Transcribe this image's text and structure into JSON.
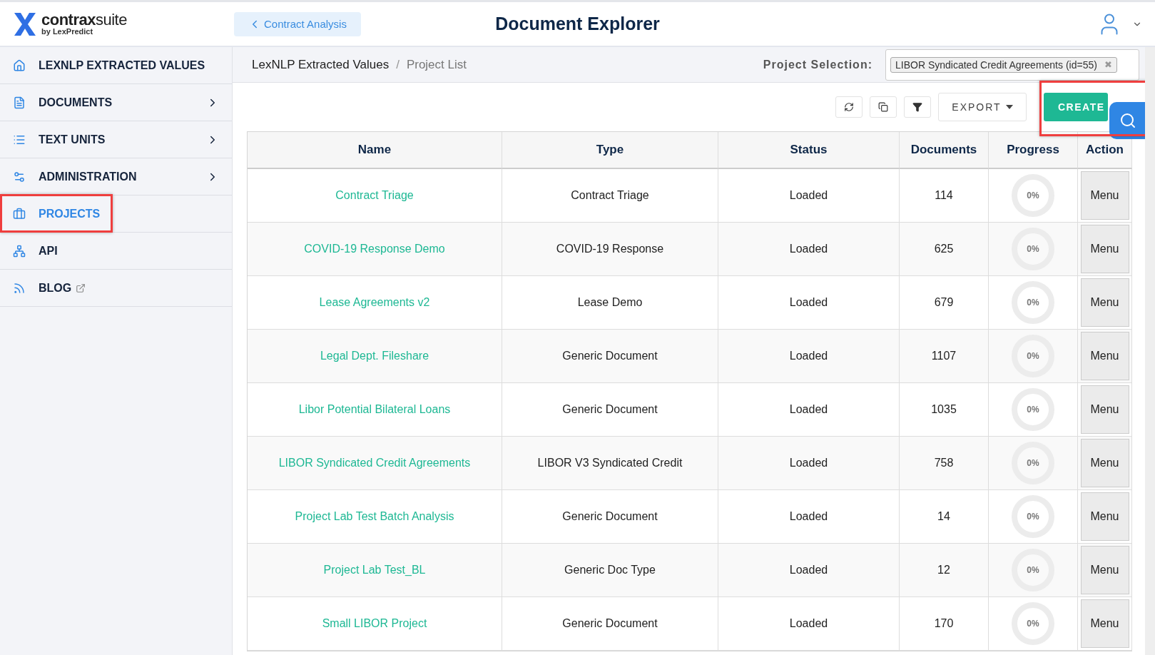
{
  "header": {
    "logo": {
      "name": "contrax",
      "suffix": "suite",
      "byline": "by LexPredict"
    },
    "back_button": "Contract Analysis",
    "title": "Document Explorer"
  },
  "sidebar": {
    "items": [
      {
        "label": "LEXNLP EXTRACTED VALUES",
        "has_children": false,
        "selected": false,
        "highlighted": false
      },
      {
        "label": "DOCUMENTS",
        "has_children": true,
        "selected": false,
        "highlighted": false
      },
      {
        "label": "TEXT UNITS",
        "has_children": true,
        "selected": false,
        "highlighted": false
      },
      {
        "label": "ADMINISTRATION",
        "has_children": true,
        "selected": false,
        "highlighted": false
      },
      {
        "label": "PROJECTS",
        "has_children": false,
        "selected": true,
        "highlighted": true
      },
      {
        "label": "API",
        "has_children": false,
        "selected": false,
        "highlighted": false
      },
      {
        "label": "BLOG",
        "has_children": false,
        "external": true,
        "selected": false,
        "highlighted": false
      }
    ]
  },
  "breadcrumb": {
    "items": [
      "LexNLP Extracted Values",
      "Project List"
    ],
    "separator": "/"
  },
  "project_selection": {
    "label": "Project Selection:",
    "value": "LIBOR Syndicated Credit Agreements (id=55)",
    "remove": "✖"
  },
  "toolbar": {
    "export": "EXPORT",
    "create": "CREATE",
    "create_highlighted": true
  },
  "table": {
    "columns": [
      "Name",
      "Type",
      "Status",
      "Documents",
      "Progress",
      "Action"
    ],
    "rows": [
      {
        "name": "Contract Triage",
        "type": "Contract Triage",
        "status": "Loaded",
        "documents": "114",
        "progress": "0%",
        "action": "Menu"
      },
      {
        "name": "COVID-19 Response Demo",
        "type": "COVID-19 Response",
        "status": "Loaded",
        "documents": "625",
        "progress": "0%",
        "action": "Menu"
      },
      {
        "name": "Lease Agreements v2",
        "type": "Lease Demo",
        "status": "Loaded",
        "documents": "679",
        "progress": "0%",
        "action": "Menu"
      },
      {
        "name": "Legal Dept. Fileshare",
        "type": "Generic Document",
        "status": "Loaded",
        "documents": "1107",
        "progress": "0%",
        "action": "Menu"
      },
      {
        "name": "Libor Potential Bilateral Loans",
        "type": "Generic Document",
        "status": "Loaded",
        "documents": "1035",
        "progress": "0%",
        "action": "Menu"
      },
      {
        "name": "LIBOR Syndicated Credit Agreements",
        "type": "LIBOR V3 Syndicated Credit",
        "status": "Loaded",
        "documents": "758",
        "progress": "0%",
        "action": "Menu"
      },
      {
        "name": "Project Lab Test Batch Analysis",
        "type": "Generic Document",
        "status": "Loaded",
        "documents": "14",
        "progress": "0%",
        "action": "Menu"
      },
      {
        "name": "Project Lab Test_BL",
        "type": "Generic Doc Type",
        "status": "Loaded",
        "documents": "12",
        "progress": "0%",
        "action": "Menu"
      },
      {
        "name": "Small LIBOR Project",
        "type": "Generic Document",
        "status": "Loaded",
        "documents": "170",
        "progress": "0%",
        "action": "Menu"
      }
    ]
  }
}
